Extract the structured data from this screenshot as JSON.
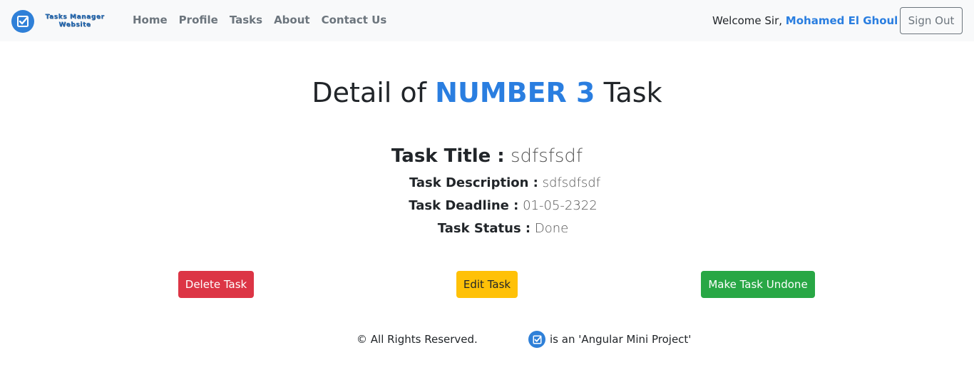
{
  "brand": {
    "line1": "Tasks Manager",
    "line2": "Website"
  },
  "nav": {
    "items": [
      {
        "label": "Home"
      },
      {
        "label": "Profile"
      },
      {
        "label": "Tasks"
      },
      {
        "label": "About"
      },
      {
        "label": "Contact Us"
      }
    ],
    "welcome_prefix": "Welcome Sir,",
    "user_name": "Mohamed El Ghoul",
    "sign_out_label": "Sign Out"
  },
  "page": {
    "heading_prefix": "Detail of",
    "heading_accent": "NUMBER 3",
    "heading_suffix": "Task"
  },
  "task": {
    "title_label": "Task Title :",
    "title_value": "sdfsfsdf",
    "description_label": "Task Description :",
    "description_value": "sdfsdfsdf",
    "deadline_label": "Task Deadline :",
    "deadline_value": "01-05-2322",
    "status_label": "Task Status :",
    "status_value": "Done"
  },
  "actions": {
    "delete_label": "Delete Task",
    "edit_label": "Edit Task",
    "undone_label": "Make Task Undone"
  },
  "footer": {
    "rights": "© All Rights Reserved.",
    "project_note": "is an 'Angular Mini Project'"
  },
  "colors": {
    "accent": "#2a7ee0",
    "danger": "#dc3545",
    "warning": "#ffc107",
    "success": "#28a745"
  },
  "icons": {
    "brand_logo": "checkbox-check-icon",
    "footer_logo": "checkbox-check-icon"
  }
}
